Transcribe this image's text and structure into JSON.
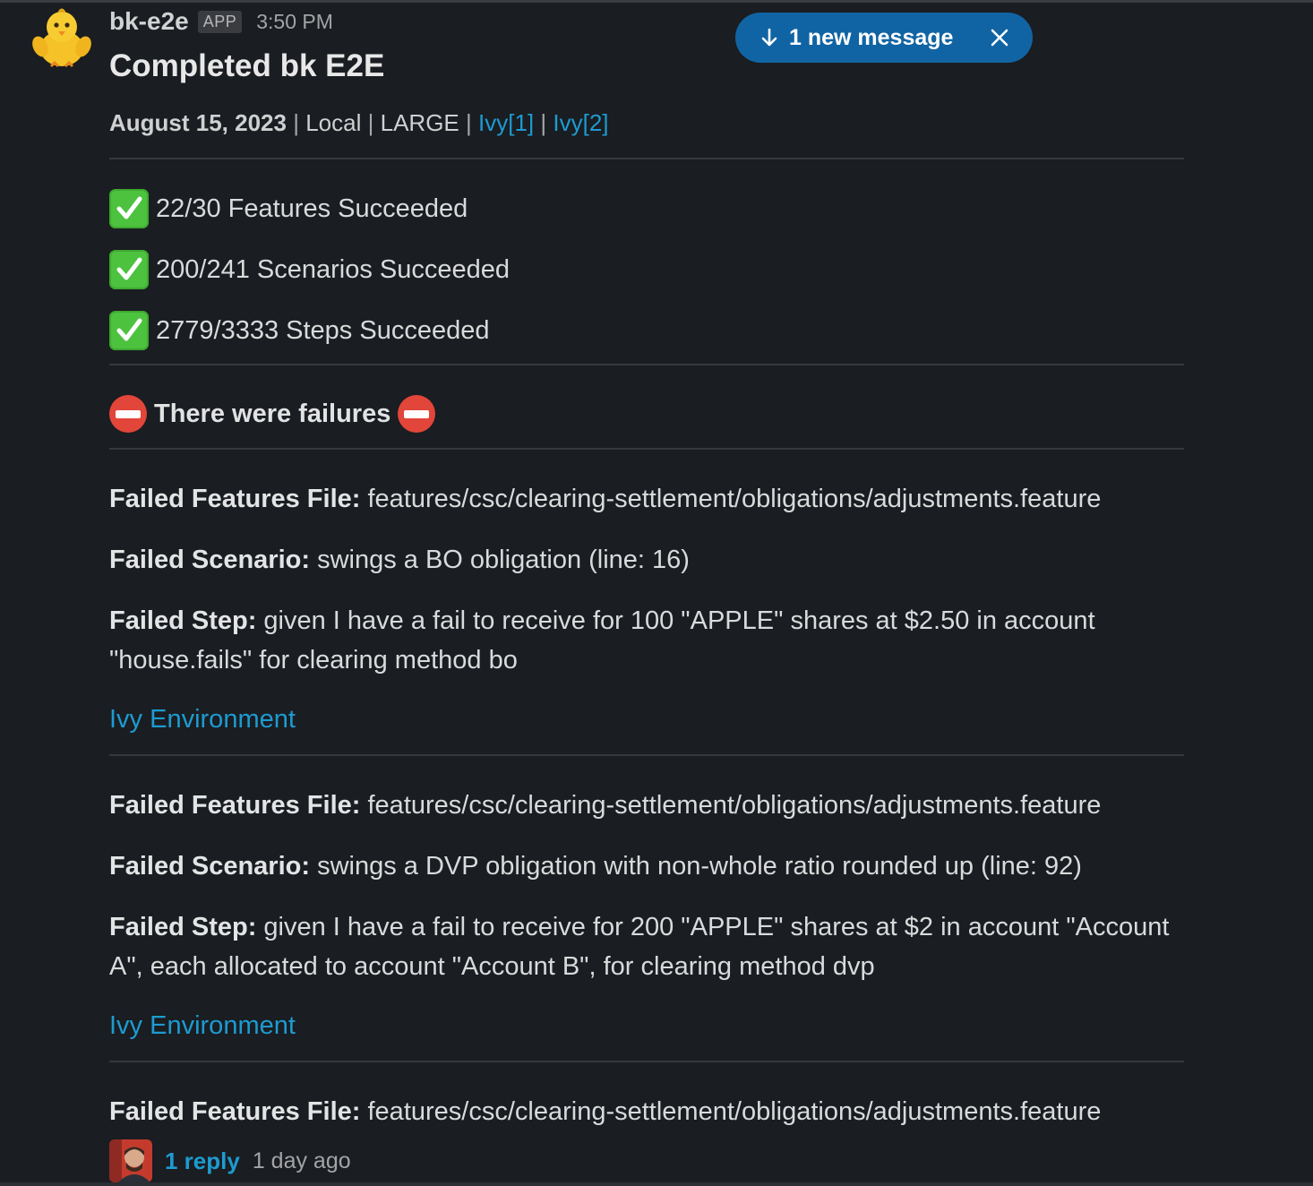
{
  "message": {
    "sender": "bk-e2e",
    "badge": "APP",
    "time": "3:50 PM",
    "title": "Completed bk E2E",
    "meta": {
      "date": "August 15, 2023",
      "sep": "|",
      "env": "Local",
      "size": "LARGE",
      "link1": "Ivy[1]",
      "link2": "Ivy[2]"
    },
    "stats": [
      "22/30 Features Succeeded",
      "200/241 Scenarios Succeeded",
      "2779/3333 Steps Succeeded"
    ],
    "failures_heading": "There were failures",
    "failures": [
      {
        "file_label": "Failed Features File",
        "file_value": "features/csc/clearing-settlement/obligations/adjustments.feature",
        "scenario_label": "Failed Scenario:",
        "scenario_value": "swings a BO obligation (line: 16)",
        "step_label": "Failed Step:",
        "step_value": "given I have a fail to receive for 100 \"APPLE\" shares at $2.50 in account \"house.fails\" for clearing method bo",
        "env_link": "Ivy Environment"
      },
      {
        "file_label": "Failed Features File",
        "file_value": "features/csc/clearing-settlement/obligations/adjustments.feature",
        "scenario_label": "Failed Scenario:",
        "scenario_value": "swings a DVP obligation with non-whole ratio rounded up (line: 92)",
        "step_label": "Failed Step:",
        "step_value": "given I have a fail to receive for 200 \"APPLE\" shares at $2 in account \"Account A\", each allocated to account \"Account B\", for clearing method dvp",
        "env_link": "Ivy Environment"
      },
      {
        "file_label": "Failed Features File",
        "file_value": "features/csc/clearing-settlement/obligations/adjustments.feature"
      }
    ],
    "thread": {
      "reply_count": "1 reply",
      "reply_time": "1 day ago"
    }
  },
  "toast": {
    "label": "1 new message"
  },
  "colors": {
    "background": "#1a1d21",
    "link": "#1d9bd1",
    "toast": "#1164a3",
    "check": "#4cc23e",
    "no_entry": "#e2453a"
  }
}
